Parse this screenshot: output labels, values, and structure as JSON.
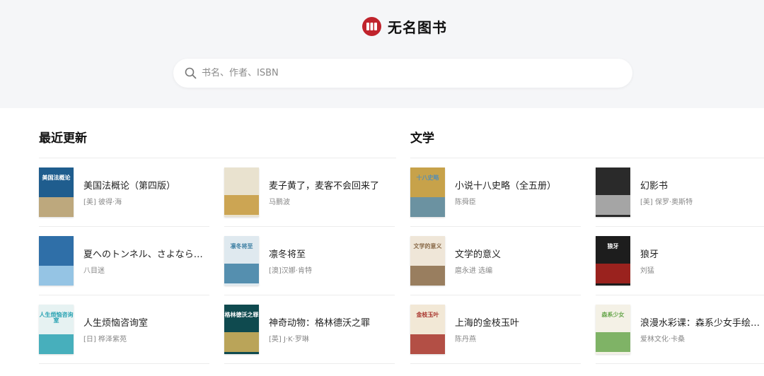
{
  "brand": {
    "name": "无名图书",
    "accent": "#c0232c"
  },
  "search": {
    "placeholder": "书名、作者、ISBN"
  },
  "sections": [
    {
      "title": "最近更新",
      "books": [
        {
          "title": "美国法概论（第四版）",
          "author": "[美] 彼得·海",
          "cover": {
            "bg": "#1f5d8e",
            "accent": "#d9b57a",
            "text": "美国法概论"
          }
        },
        {
          "title": "麦子黄了，麦客不会回来了",
          "author": "马鹏波",
          "cover": {
            "bg": "#e9e2cf",
            "accent": "#c79a3d",
            "text": ""
          }
        },
        {
          "title": "夏へのトンネル、さよならの...",
          "author": "八目迷",
          "cover": {
            "bg": "#2f6fa8",
            "accent": "#a7d3ef",
            "text": ""
          }
        },
        {
          "title": "凛冬将至",
          "author": "[澳]汉娜·肯特",
          "cover": {
            "bg": "#dfe9ef",
            "accent": "#3d7fa3",
            "text": "凛冬将至"
          }
        },
        {
          "title": "人生烦恼咨询室",
          "author": "[日] 桦泽紫苑",
          "cover": {
            "bg": "#e6f2f2",
            "accent": "#2aa3b3",
            "text": "人生烦恼咨询室"
          }
        },
        {
          "title": "神奇动物：格林德沃之罪",
          "author": "[英] J·K·罗琳",
          "cover": {
            "bg": "#0f4a4f",
            "accent": "#d8b45a",
            "text": "格林德沃之罪"
          }
        }
      ]
    },
    {
      "title": "文学",
      "books": [
        {
          "title": "小说十八史略（全五册）",
          "author": "陈舜臣",
          "cover": {
            "bg": "#c7a24a",
            "accent": "#5a8fb0",
            "text": "十八史略"
          }
        },
        {
          "title": "幻影书",
          "author": "[美] 保罗·奥斯特",
          "cover": {
            "bg": "#2a2a2a",
            "accent": "#bbbbbb",
            "text": ""
          }
        },
        {
          "title": "文学的意义",
          "author": "扈永进 选编",
          "cover": {
            "bg": "#efe6d8",
            "accent": "#8a6b4a",
            "text": "文学的意义"
          }
        },
        {
          "title": "狼牙",
          "author": "刘猛",
          "cover": {
            "bg": "#1d1d1d",
            "accent": "#b0231f",
            "text": "狼牙"
          }
        },
        {
          "title": "上海的金枝玉叶",
          "author": "陈丹燕",
          "cover": {
            "bg": "#f2e8d6",
            "accent": "#a8342c",
            "text": "金枝玉叶"
          }
        },
        {
          "title": "浪漫水彩课：森系少女手绘技法",
          "author": "爱林文化·卡桑",
          "cover": {
            "bg": "#f4f1e6",
            "accent": "#6aa84f",
            "text": "森系少女"
          }
        }
      ]
    }
  ]
}
